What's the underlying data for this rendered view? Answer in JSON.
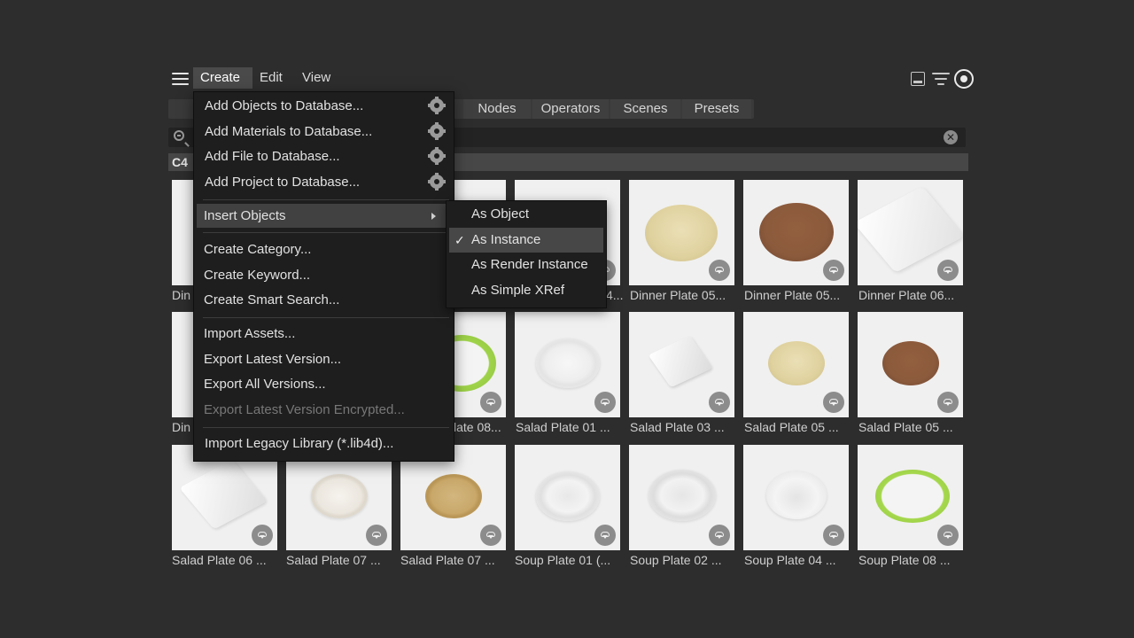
{
  "menubar": {
    "items": [
      "Create",
      "Edit",
      "View"
    ]
  },
  "tabs": [
    "Nodes",
    "Operators",
    "Scenes",
    "Presets"
  ],
  "breadcrumb": "C4",
  "search": {
    "clear_symbol": "✕"
  },
  "create_menu": {
    "add_objects": "Add Objects to Database...",
    "add_materials": "Add Materials to Database...",
    "add_file": "Add File to Database...",
    "add_project": "Add Project to Database...",
    "insert_objects": "Insert Objects",
    "create_category": "Create Category...",
    "create_keyword": "Create Keyword...",
    "create_smart_search": "Create Smart Search...",
    "import_assets": "Import Assets...",
    "export_latest": "Export Latest Version...",
    "export_all": "Export All Versions...",
    "export_encrypted": "Export Latest Version Encrypted...",
    "import_legacy": "Import Legacy Library (*.lib4d)..."
  },
  "insert_submenu": {
    "as_object": "As Object",
    "as_instance": "As Instance",
    "as_render_instance": "As Render Instance",
    "as_simple_xref": "As Simple XRef",
    "check_mark": "✓",
    "selected": "As Instance"
  },
  "grid": {
    "row1": [
      "Din",
      "",
      "",
      "4...",
      "Dinner Plate 05...",
      "Dinner Plate 05...",
      "Dinner Plate 06..."
    ],
    "row2": [
      "Din",
      "",
      "late 08...",
      "Salad Plate 01 ...",
      "Salad Plate 03 ...",
      "Salad Plate 05 ...",
      "Salad Plate 05 ..."
    ],
    "row3": [
      "Salad Plate 06 ...",
      "Salad Plate 07 ...",
      "Salad Plate 07 ...",
      "Soup Plate 01 (...",
      "Soup Plate 02 ...",
      "Soup Plate 04 ...",
      "Soup Plate 08 ..."
    ]
  },
  "colors": {
    "background": "#2d2d2d",
    "menu_bg": "#1e1e1e",
    "highlight": "#414141",
    "plate_cream": "#e3d6a8",
    "plate_brown": "#8b5a3c",
    "plate_green": "#9fd34a",
    "plate_gold": "#c9a86a"
  }
}
